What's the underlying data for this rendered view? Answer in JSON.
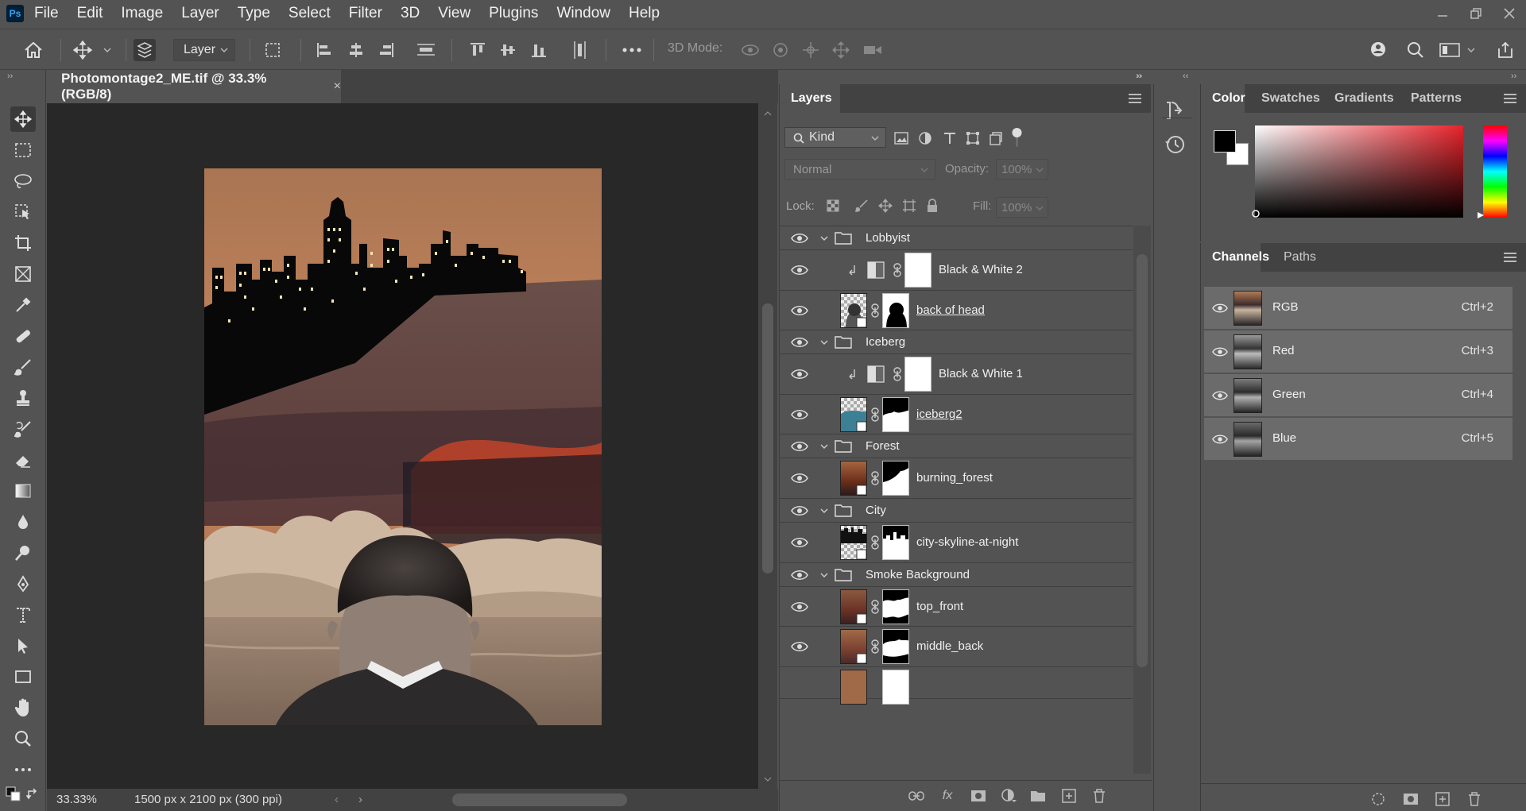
{
  "app": {
    "logo_text": "Ps"
  },
  "menu": [
    "File",
    "Edit",
    "Image",
    "Layer",
    "Type",
    "Select",
    "Filter",
    "3D",
    "View",
    "Plugins",
    "Window",
    "Help"
  ],
  "options_bar": {
    "layer_select": "Layer",
    "mode_3d_label": "3D Mode:"
  },
  "document": {
    "tab_title": "Photomontage2_ME.tif @ 33.3% (RGB/8)",
    "close_glyph": "×",
    "zoom": "33.33%",
    "size_info": "1500 px x 2100 px (300 ppi)",
    "status_arrow": "›",
    "scroll_left": "‹"
  },
  "layers_panel": {
    "tab": "Layers",
    "filter_kind": "Kind",
    "blend_mode": "Normal",
    "opacity_label": "Opacity:",
    "opacity": "100%",
    "lock_label": "Lock:",
    "fill_label": "Fill:",
    "fill": "100%",
    "fx_label": "fx",
    "rows": [
      {
        "name": "Lobbyist",
        "type": "group"
      },
      {
        "name": "Black & White 2",
        "type": "adjustment"
      },
      {
        "name": "back of head",
        "type": "layer"
      },
      {
        "name": "Iceberg",
        "type": "group"
      },
      {
        "name": "Black & White 1",
        "type": "adjustment"
      },
      {
        "name": "iceberg2",
        "type": "layer"
      },
      {
        "name": "Forest",
        "type": "group"
      },
      {
        "name": "burning_forest",
        "type": "layer"
      },
      {
        "name": "City",
        "type": "group"
      },
      {
        "name": "city-skyline-at-night",
        "type": "layer"
      },
      {
        "name": "Smoke Background",
        "type": "group"
      },
      {
        "name": "top_front",
        "type": "layer"
      },
      {
        "name": "middle_back",
        "type": "layer"
      }
    ]
  },
  "color_panel": {
    "tabs": [
      "Color",
      "Swatches",
      "Gradients",
      "Patterns"
    ],
    "foreground": "#000000",
    "background": "#ffffff"
  },
  "channels_panel": {
    "tabs": [
      "Channels",
      "Paths"
    ],
    "channels": [
      {
        "name": "RGB",
        "shortcut": "Ctrl+2"
      },
      {
        "name": "Red",
        "shortcut": "Ctrl+3"
      },
      {
        "name": "Green",
        "shortcut": "Ctrl+4"
      },
      {
        "name": "Blue",
        "shortcut": "Ctrl+5"
      }
    ]
  },
  "colors": {
    "ui_bg": "#535353",
    "panel_dark": "#424242",
    "canvas_bg": "#282828",
    "accent": "#31a8ff"
  }
}
